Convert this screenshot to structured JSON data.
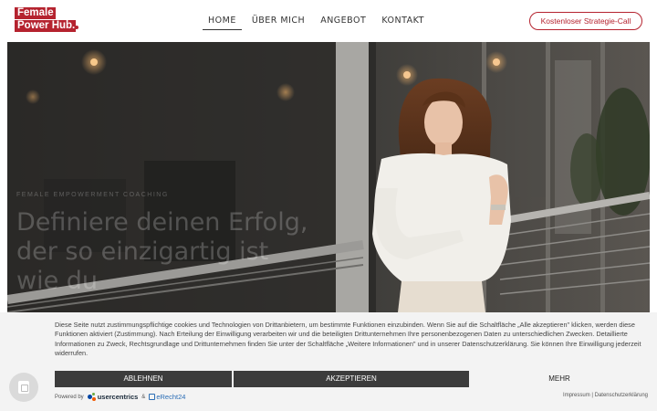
{
  "logo": {
    "line1": "Female",
    "line2": "Power Hub."
  },
  "nav": {
    "items": [
      {
        "label": "HOME",
        "active": true
      },
      {
        "label": "ÜBER MICH",
        "active": false
      },
      {
        "label": "ANGEBOT",
        "active": false
      },
      {
        "label": "KONTAKT",
        "active": false
      }
    ],
    "cta_label": "Kostenloser Strategie-Call"
  },
  "hero": {
    "eyebrow": "FEMALE EMPOWERMENT COACHING",
    "heading": "Definiere deinen Erfolg, der so einzigartig ist wie du"
  },
  "cookie": {
    "text": "Diese Seite nutzt zustimmungspflichtige cookies und Technologien von Drittanbietern, um bestimmte Funktionen einzubinden. Wenn Sie auf die Schaltfläche „Alle akzeptieren\" klicken, werden diese Funktionen aktiviert (Zustimmung). Nach Erteilung der Einwilligung verarbeiten wir und die beteiligten Drittunternehmen Ihre personenbezogenen Daten zu unterschiedlichen Zwecken. Detaillierte Informationen zu Zweck, Rechtsgrundlage und Drittunternehmen finden Sie unter der Schaltfläche „Weitere Informationen\" und in unserer Datenschutzerklärung. Sie können Ihre Einwilligung jederzeit widerrufen.",
    "deny_label": "ABLEHNEN",
    "accept_label": "AKZEPTIEREN",
    "more_label": "MEHR",
    "powered_by": "Powered by",
    "usercentrics": "usercentrics",
    "amp": "&",
    "erecht": "eRecht24",
    "impressum": "Impressum",
    "separator": "|",
    "datenschutz": "Datenschutzerklärung"
  },
  "colors": {
    "brand": "#b5232f",
    "button_dark": "#3c3c3c",
    "banner_bg": "#f3f3f3"
  },
  "icons": {
    "privacy_fab": "fingerprint-privacy-icon"
  }
}
